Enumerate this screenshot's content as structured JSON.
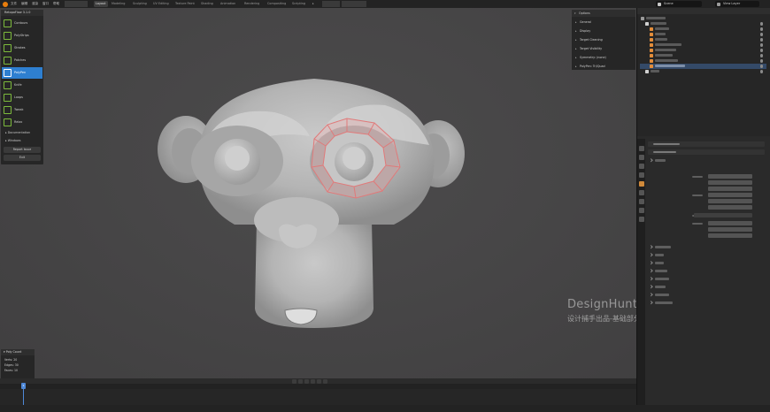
{
  "topbar": {
    "menus": [
      "文件",
      "编辑",
      "渲染",
      "窗口",
      "帮助"
    ],
    "tabs": [
      {
        "label": "Layout",
        "active": true
      },
      {
        "label": "Modeling",
        "active": false
      },
      {
        "label": "Sculpting",
        "active": false
      },
      {
        "label": "UV Editing",
        "active": false
      },
      {
        "label": "Texture Paint",
        "active": false
      },
      {
        "label": "Shading",
        "active": false
      },
      {
        "label": "Animation",
        "active": false
      },
      {
        "label": "Rendering",
        "active": false
      },
      {
        "label": "Compositing",
        "active": false
      },
      {
        "label": "Scripting",
        "active": false
      }
    ],
    "scene": "Scene",
    "view_layer": "View Layer"
  },
  "polyquilt_panel": {
    "title": "RetopoFlow 3.1.0",
    "tools": [
      {
        "label": "Contours",
        "icon": "contours-icon",
        "active": false
      },
      {
        "label": "PolyStrips",
        "icon": "polystrips-icon",
        "active": false
      },
      {
        "label": "Strokes",
        "icon": "strokes-icon",
        "active": false
      },
      {
        "label": "Patches",
        "icon": "patches-icon",
        "active": false
      },
      {
        "label": "PolyPen",
        "icon": "polypen-icon",
        "active": true
      },
      {
        "label": "Knife",
        "icon": "knife-icon",
        "active": false
      },
      {
        "label": "Loops",
        "icon": "loops-icon",
        "active": false
      },
      {
        "label": "Tweak",
        "icon": "tweak-icon",
        "active": false
      },
      {
        "label": "Relax",
        "icon": "relax-icon",
        "active": false
      }
    ],
    "sections": [
      "Documentation",
      "Windows"
    ],
    "report_label": "Report Issue",
    "exit_label": "Exit"
  },
  "options_panel": {
    "title": "Options",
    "rows": [
      "General",
      "Display",
      "Target Cleaning",
      "Target Visibility",
      "Symmetry: (none)",
      "PolyPen: Tri/Quad"
    ]
  },
  "poly_count": {
    "title": "Poly Count",
    "rows": [
      {
        "label": "Verts:",
        "value": "20"
      },
      {
        "label": "Edges:",
        "value": "30"
      },
      {
        "label": "Faces:",
        "value": "10"
      }
    ]
  },
  "watermark": {
    "line1": "DesignHunting",
    "line2": "设计捕手出品-基础部分"
  },
  "colors": {
    "accent": "#2e7fd0",
    "tool_icon": "#7dbb3c",
    "retopo_face": "#e8a8a8",
    "timeline_cursor": "#4f89d8"
  },
  "timeline": {
    "current_frame": "1"
  }
}
